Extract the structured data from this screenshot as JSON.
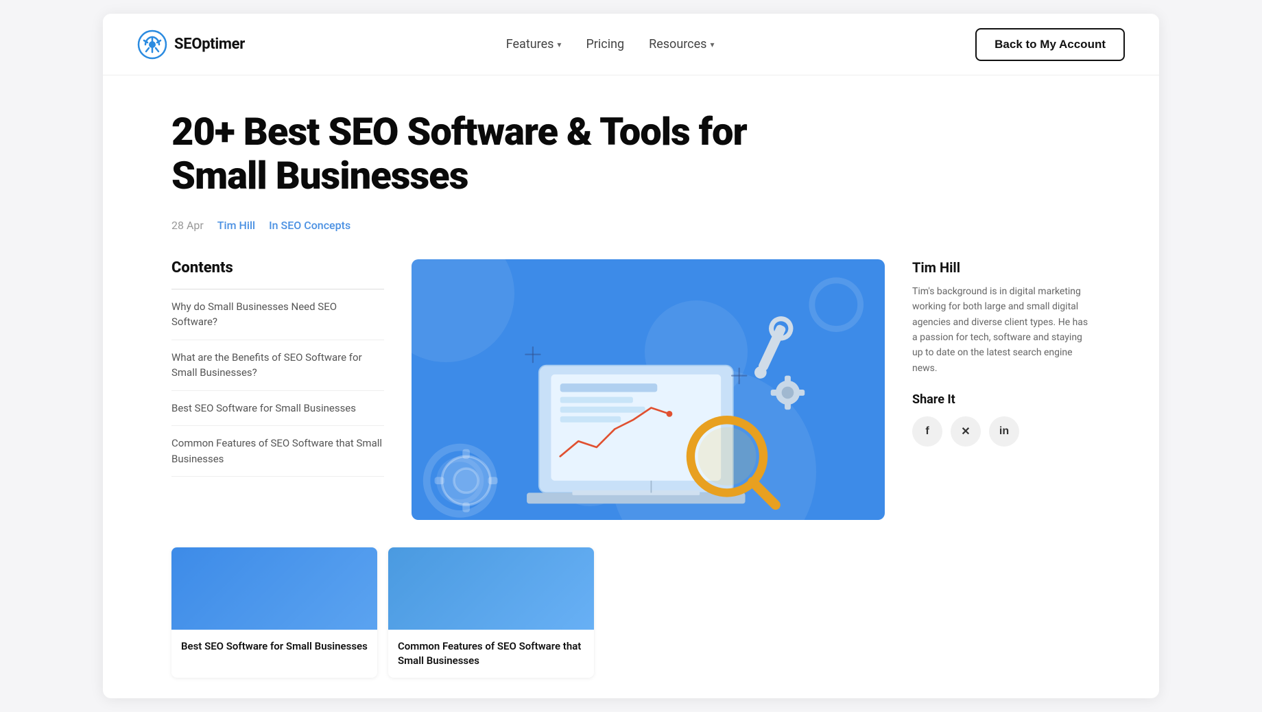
{
  "header": {
    "logo_text": "SEOptimer",
    "nav": [
      {
        "label": "Features",
        "has_dropdown": true
      },
      {
        "label": "Pricing",
        "has_dropdown": false
      },
      {
        "label": "Resources",
        "has_dropdown": true
      }
    ],
    "back_button_label": "Back to My Account"
  },
  "article": {
    "title": "20+ Best SEO Software & Tools for Small Businesses",
    "meta": {
      "date": "28 Apr",
      "author": "Tim Hill",
      "category": "In SEO Concepts"
    },
    "toc": {
      "title": "Contents",
      "items": [
        {
          "label": "Why do Small Businesses Need SEO Software?",
          "active": false
        },
        {
          "label": "What are the Benefits of SEO Software for Small Businesses?",
          "active": false
        },
        {
          "label": "Best SEO Software for Small Businesses",
          "active": false
        },
        {
          "label": "Common Features of SEO Software that Small Businesses",
          "active": false
        }
      ]
    },
    "author_bio": {
      "name": "Tim Hill",
      "bio": "Tim's background is in digital marketing working for both large and small digital agencies and diverse client types. He has a passion for tech, software and staying up to date on the latest search engine news."
    },
    "share": {
      "title": "Share It",
      "buttons": [
        {
          "label": "f",
          "name": "facebook"
        },
        {
          "label": "𝕏",
          "name": "x-twitter"
        },
        {
          "label": "in",
          "name": "linkedin"
        }
      ]
    }
  },
  "bottom_articles": [
    {
      "title": "Best SEO Software for Small Businesses"
    },
    {
      "title": "Common Features of SEO Software that Small Businesses"
    }
  ],
  "icons": {
    "chevron_down": "▾",
    "logo_gear": "⚙"
  }
}
